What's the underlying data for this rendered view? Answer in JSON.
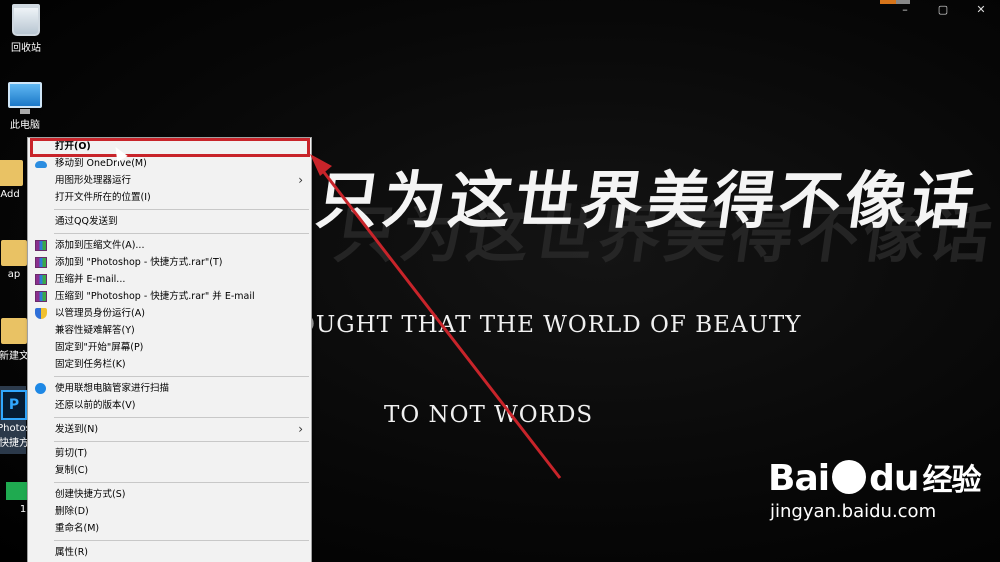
{
  "wallpaper": {
    "calligraphy": "只为这世界美得不像话",
    "english_line1": "OUGHT THAT THE WORLD OF BEAUTY",
    "english_line2": "TO NOT WORDS"
  },
  "desktop": {
    "icons": [
      {
        "label": "回收站",
        "icon": "recycle-bin-icon"
      },
      {
        "label": "此电脑",
        "icon": "computer-icon"
      },
      {
        "label": "Add",
        "icon": "folder-icon"
      },
      {
        "label": "ap",
        "icon": "folder-icon"
      },
      {
        "label": "新建文",
        "icon": "folder-icon"
      },
      {
        "label": "Photos",
        "label2": "快捷方",
        "icon": "photoshop-icon"
      },
      {
        "label": "1",
        "icon": "green-app-icon"
      }
    ]
  },
  "window_controls": {
    "minimize": "–",
    "maximize": "▢",
    "close": "✕"
  },
  "context_menu": {
    "items": [
      {
        "label": "打开(O)",
        "bold": true,
        "icon": null
      },
      {
        "label": "移动到 OneDrive(M)",
        "icon": "onedrive-icon"
      },
      {
        "label": "用图形处理器运行",
        "submenu": true
      },
      {
        "label": "打开文件所在的位置(I)"
      },
      {
        "separator": true
      },
      {
        "label": "通过QQ发送到"
      },
      {
        "separator": true
      },
      {
        "label": "添加到压缩文件(A)...",
        "icon": "winrar-icon"
      },
      {
        "label": "添加到 \"Photoshop - 快捷方式.rar\"(T)",
        "icon": "winrar-icon"
      },
      {
        "label": "压缩并 E-mail...",
        "icon": "winrar-icon"
      },
      {
        "label": "压缩到 \"Photoshop - 快捷方式.rar\" 并 E-mail",
        "icon": "winrar-icon"
      },
      {
        "label": "以管理员身份运行(A)",
        "icon": "uac-shield-icon"
      },
      {
        "label": "兼容性疑难解答(Y)"
      },
      {
        "label": "固定到\"开始\"屏幕(P)"
      },
      {
        "label": "固定到任务栏(K)"
      },
      {
        "separator": true
      },
      {
        "label": "使用联想电脑管家进行扫描",
        "icon": "lenovo-icon"
      },
      {
        "label": "还原以前的版本(V)"
      },
      {
        "separator": true
      },
      {
        "label": "发送到(N)",
        "submenu": true
      },
      {
        "separator": true
      },
      {
        "label": "剪切(T)"
      },
      {
        "label": "复制(C)"
      },
      {
        "separator": true
      },
      {
        "label": "创建快捷方式(S)"
      },
      {
        "label": "删除(D)"
      },
      {
        "label": "重命名(M)"
      },
      {
        "separator": true
      },
      {
        "label": "属性(R)"
      }
    ]
  },
  "annotation": {
    "color": "#c8242a"
  },
  "watermark": {
    "logo_text": "Bai",
    "logo_text2": "du",
    "logo_cn": "经验",
    "url": "jingyan.baidu.com"
  }
}
